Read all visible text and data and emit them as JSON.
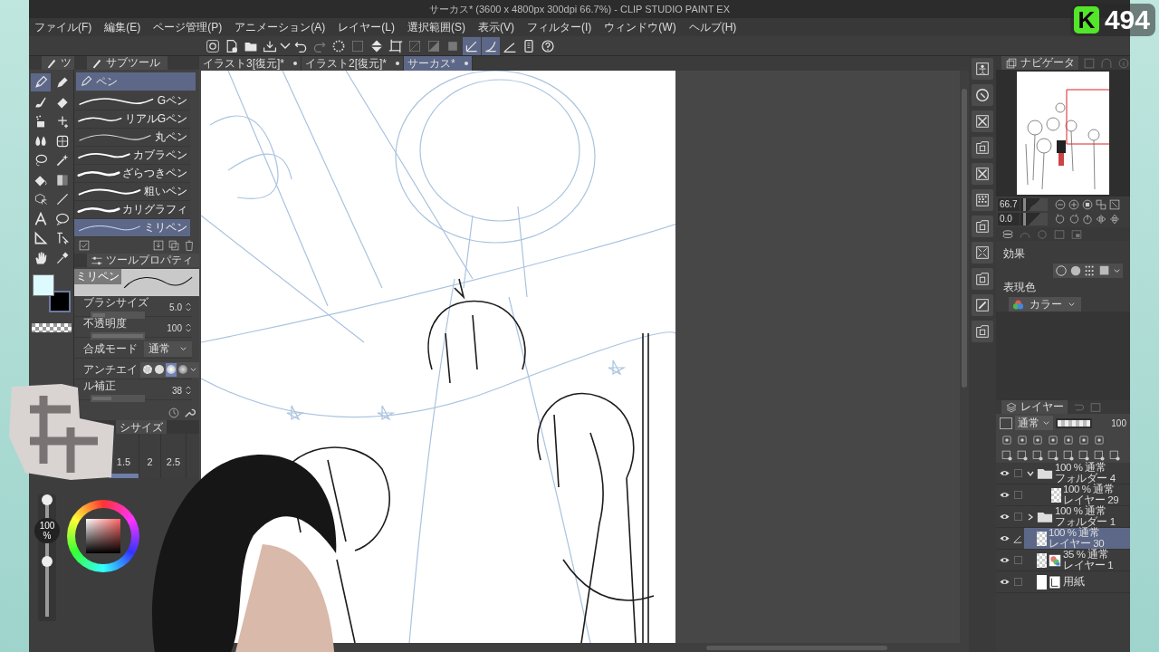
{
  "title_bar": {
    "title": "サーカス* (3600 x 4800px 300dpi 66.7%)  - CLIP STUDIO PAINT EX"
  },
  "menu": [
    "ファイル(F)",
    "編集(E)",
    "ページ管理(P)",
    "アニメーション(A)",
    "レイヤー(L)",
    "選択範囲(S)",
    "表示(V)",
    "フィルター(I)",
    "ウィンドウ(W)",
    "ヘルプ(H)"
  ],
  "toolbar": [
    {
      "disabled": false,
      "selected": false
    },
    {
      "disabled": false,
      "selected": false
    },
    {
      "disabled": false,
      "selected": false
    },
    {
      "disabled": false,
      "selected": false
    },
    {
      "disabled": false,
      "selected": false
    },
    {
      "disabled": false,
      "selected": false
    },
    {
      "disabled": true,
      "selected": false
    },
    {
      "disabled": false,
      "selected": false
    },
    {
      "disabled": true,
      "selected": false
    },
    {
      "disabled": false,
      "selected": false
    },
    {
      "disabled": false,
      "selected": false
    },
    {
      "disabled": true,
      "selected": false
    },
    {
      "disabled": true,
      "selected": false
    },
    {
      "disabled": true,
      "selected": false
    },
    {
      "disabled": false,
      "selected": true
    },
    {
      "disabled": false,
      "selected": true
    },
    {
      "disabled": false,
      "selected": false
    },
    {
      "disabled": false,
      "selected": false
    },
    {
      "disabled": false,
      "selected": false
    }
  ],
  "doc_tabs": [
    {
      "label": "イラスト3[復元]*",
      "selected": false
    },
    {
      "label": "イラスト2[復元]*",
      "selected": false
    },
    {
      "label": "サーカス*",
      "selected": true
    }
  ],
  "tool_palette": {
    "tab": "ツ",
    "tools": [
      {
        "selected": true
      },
      {
        "selected": false
      },
      {
        "selected": false
      },
      {
        "selected": false
      },
      {
        "selected": false
      },
      {
        "selected": false
      },
      {
        "selected": false
      },
      {
        "selected": false
      },
      {
        "selected": false
      },
      {
        "selected": false
      },
      {
        "selected": false
      },
      {
        "selected": false
      },
      {
        "selected": false
      },
      {
        "selected": false
      },
      {
        "selected": false
      },
      {
        "selected": false
      },
      {
        "selected": false
      },
      {
        "selected": false
      },
      {
        "selected": false
      },
      {
        "selected": false
      }
    ]
  },
  "subtool": {
    "tab": "サブツール",
    "group": "ペン",
    "items": [
      {
        "label": "Gペン",
        "selected": false
      },
      {
        "label": "リアルGペン",
        "selected": false
      },
      {
        "label": "丸ペン",
        "selected": false
      },
      {
        "label": "カブラペン",
        "selected": false
      },
      {
        "label": "ざらつきペン",
        "selected": false
      },
      {
        "label": "粗いペン",
        "selected": false
      },
      {
        "label": "カリグラフィ",
        "selected": false
      },
      {
        "label": "ミリペン",
        "selected": true
      }
    ]
  },
  "tool_property": {
    "tab": "ツールプロパティ",
    "preview_label": "ミリペン",
    "rows": [
      {
        "kind": "slider",
        "label": "ブラシサイズ",
        "value": "5.0",
        "level": 0.25
      },
      {
        "kind": "slider",
        "label": "不透明度",
        "value": "100",
        "level": 1
      },
      {
        "kind": "select",
        "label": "合成モード",
        "value": "通常"
      },
      {
        "kind": "options",
        "label": "アンチエイ",
        "options": [
          {
            "selected": false
          },
          {
            "selected": false
          },
          {
            "selected": true
          },
          {
            "selected": false
          }
        ]
      },
      {
        "kind": "slider",
        "label": "ル補正",
        "value": "38",
        "level": 0.38
      }
    ]
  },
  "brush_size": {
    "tab": "シサイズ",
    "sizes": [
      {
        "label": "1.5",
        "selected": true
      },
      {
        "label": "2",
        "selected": false
      },
      {
        "label": "2.5",
        "selected": false
      }
    ]
  },
  "color_panel": {
    "opacity": "100 %",
    "slider": {
      "level": 1
    }
  },
  "navigator": {
    "tab": "ナビゲータ",
    "zoom": "66.7",
    "zoom_slider": {
      "level": 0.1
    },
    "rotation": "0.0",
    "rotation_slider": {
      "level": 0.1
    }
  },
  "layer_property": {
    "effect_label": "効果",
    "color_label": "表現色",
    "color_mode": "カラー"
  },
  "layer_panel": {
    "tab": "レイヤー",
    "blend": "通常",
    "opacity": "100",
    "level": 1,
    "layers": [
      {
        "kind": "folder",
        "mode": "100 % 通常",
        "name": "フォルダー 4",
        "expanded": true,
        "checked": false,
        "selected": false,
        "children": [
          {
            "kind": "raster",
            "mode": "100 % 通常",
            "name": "レイヤー 29",
            "checked": false,
            "selected": false
          }
        ]
      },
      {
        "kind": "folder",
        "mode": "100 % 通常",
        "name": "フォルダー 1",
        "expanded": false,
        "checked": false,
        "selected": false
      },
      {
        "kind": "raster",
        "mode": "100 % 通常",
        "name": "レイヤー 30",
        "selected": true
      },
      {
        "kind": "color_raster",
        "mode": "35 % 通常",
        "name": "レイヤー 1",
        "checked": false,
        "selected": false
      },
      {
        "kind": "paper",
        "name": "用紙",
        "checked": false,
        "selected": false
      }
    ]
  },
  "overlay": {
    "logo": "K",
    "count": "494"
  }
}
